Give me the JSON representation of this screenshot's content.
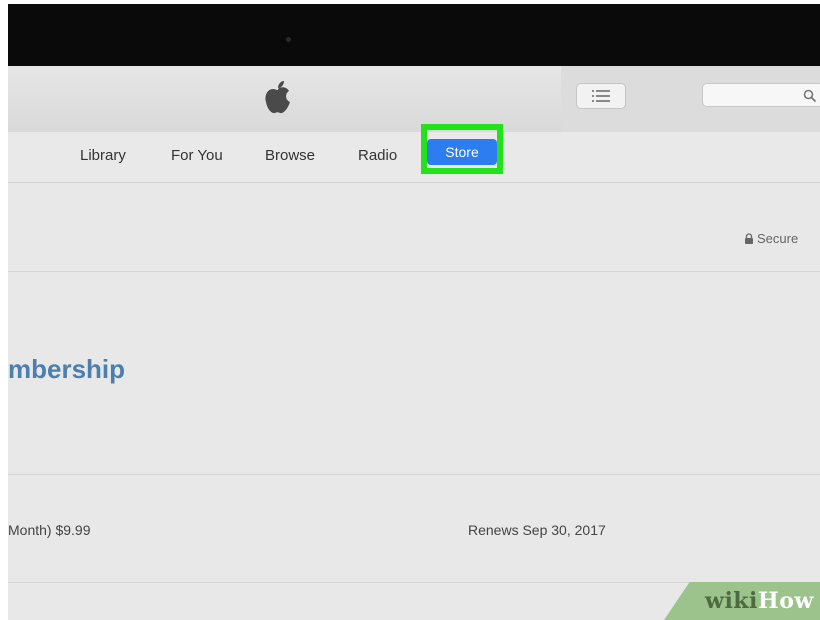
{
  "titlebar": {
    "apple_logo_icon": "apple-logo-icon",
    "list_button_icon": "list-icon",
    "search": {
      "placeholder": "",
      "icon": "search-icon"
    }
  },
  "nav": {
    "items": [
      {
        "label": "Library"
      },
      {
        "label": "For You"
      },
      {
        "label": "Browse"
      },
      {
        "label": "Radio"
      },
      {
        "label": "Store",
        "active": true
      }
    ],
    "active_color": "#2d7cf0",
    "highlight_color": "#23e21c"
  },
  "secure": {
    "label": "Secure",
    "icon": "lock-icon"
  },
  "membership": {
    "heading": "mbership"
  },
  "plan": {
    "price_text": "Month) $9.99",
    "renews_text": "Renews Sep 30, 2017"
  },
  "watermark": {
    "wiki": "wiki",
    "how": "How"
  }
}
